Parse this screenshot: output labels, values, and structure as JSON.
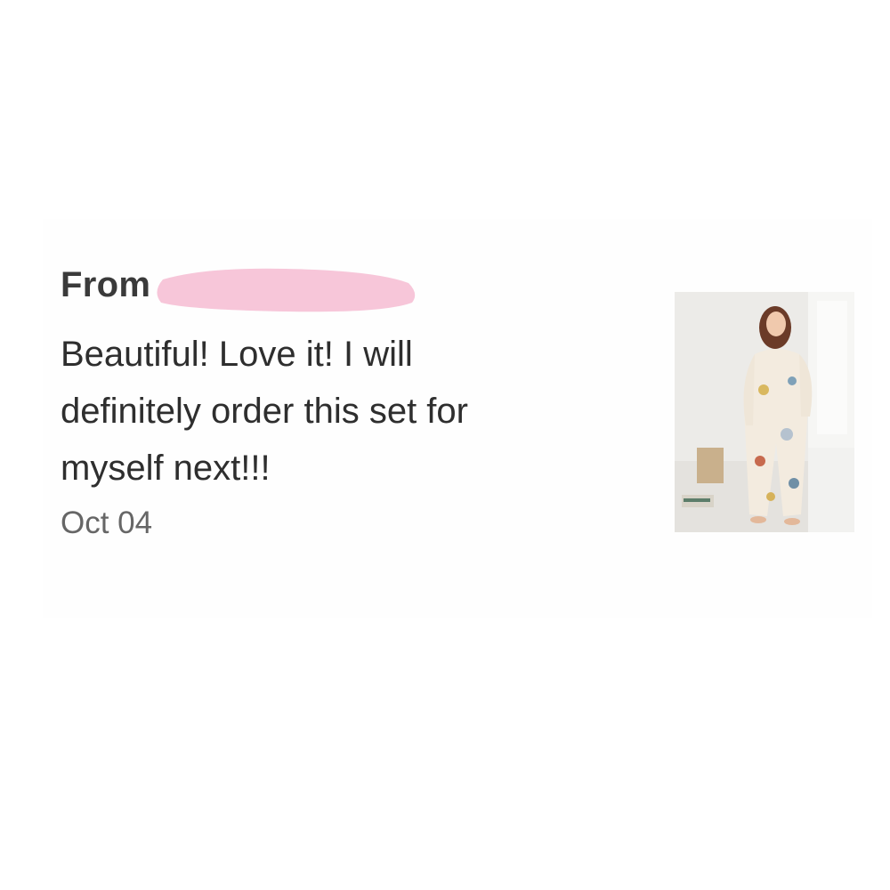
{
  "review": {
    "from_label": "From",
    "body": "Beautiful! Love it! I will definitely order this set for myself next!!!",
    "date": "Oct 04"
  },
  "colors": {
    "redaction": "#f7c6d9",
    "text_primary": "#2e2e2e",
    "text_secondary": "#666666"
  }
}
